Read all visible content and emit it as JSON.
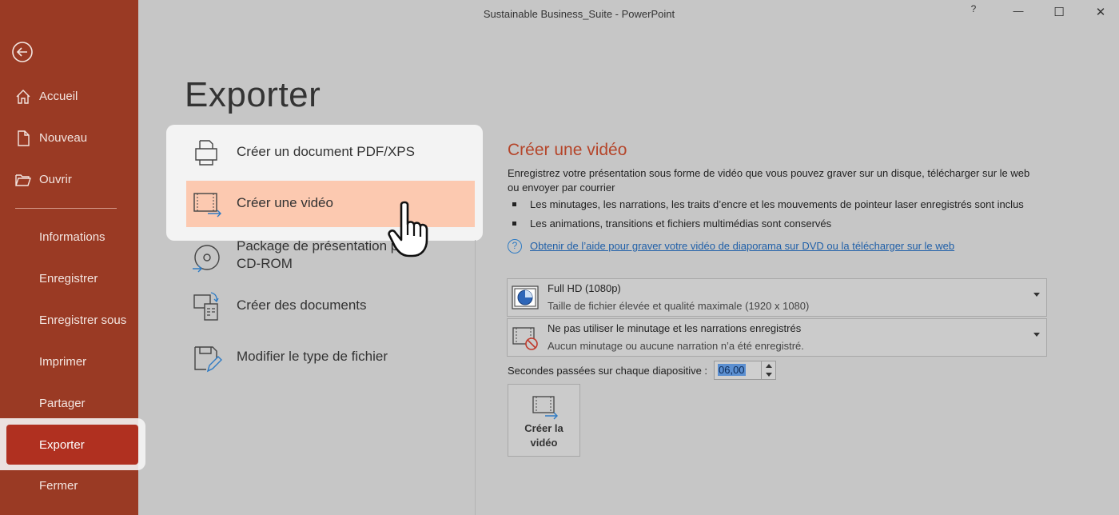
{
  "window": {
    "title": "Sustainable Business_Suite  -  PowerPoint",
    "help": "?",
    "minimize": "—",
    "maximize": "☐",
    "close": "✕"
  },
  "sidebar": {
    "items": [
      {
        "label": "Accueil",
        "icon": "home-icon"
      },
      {
        "label": "Nouveau",
        "icon": "new-document-icon"
      },
      {
        "label": "Ouvrir",
        "icon": "folder-open-icon"
      },
      {
        "label": "Informations"
      },
      {
        "label": "Enregistrer"
      },
      {
        "label": "Enregistrer sous"
      },
      {
        "label": "Imprimer"
      },
      {
        "label": "Partager"
      },
      {
        "label": "Exporter",
        "selected": true
      },
      {
        "label": "Fermer"
      }
    ]
  },
  "main": {
    "title": "Exporter",
    "options": [
      {
        "label": "Créer un document PDF/XPS",
        "icon": "pdf-document-icon"
      },
      {
        "label": "Créer une vidéo",
        "icon": "video-icon",
        "selected": true
      },
      {
        "label": "Package de présentation pour\nCD-ROM",
        "icon": "cd-rom-icon"
      },
      {
        "label": "Créer des documents",
        "icon": "handouts-icon"
      },
      {
        "label": "Modifier le type de fichier",
        "icon": "change-file-type-icon"
      }
    ]
  },
  "detail": {
    "title": "Créer une vidéo",
    "description": "Enregistrez votre présentation sous forme de vidéo que vous pouvez graver sur un disque, télécharger sur le web ou envoyer par courrier",
    "bullets": [
      "Les minutages, les narrations, les traits d’encre et les mouvements de pointeur laser enregistrés sont inclus",
      "Les animations, transitions et fichiers multimédias sont conservés"
    ],
    "help_link": "Obtenir de l’aide pour graver votre vidéo de diaporama sur DVD ou la télécharger sur le web",
    "quality": {
      "main": "Full HD (1080p)",
      "sub": "Taille de fichier élevée et qualité maximale (1920 x 1080)"
    },
    "timing": {
      "main": "Ne pas utiliser le minutage et les narrations enregistrés",
      "sub": "Aucun minutage ou aucune narration n’a été enregistré."
    },
    "seconds_label": "Secondes passées sur chaque diapositive :",
    "seconds_value": "06,00",
    "create_button": "Créer la\nvidéo"
  },
  "colors": {
    "sidebar_bg": "#9a3a24",
    "accent": "#b5452a",
    "selected_option": "#fcc9b0",
    "link": "#1f5fa8"
  }
}
